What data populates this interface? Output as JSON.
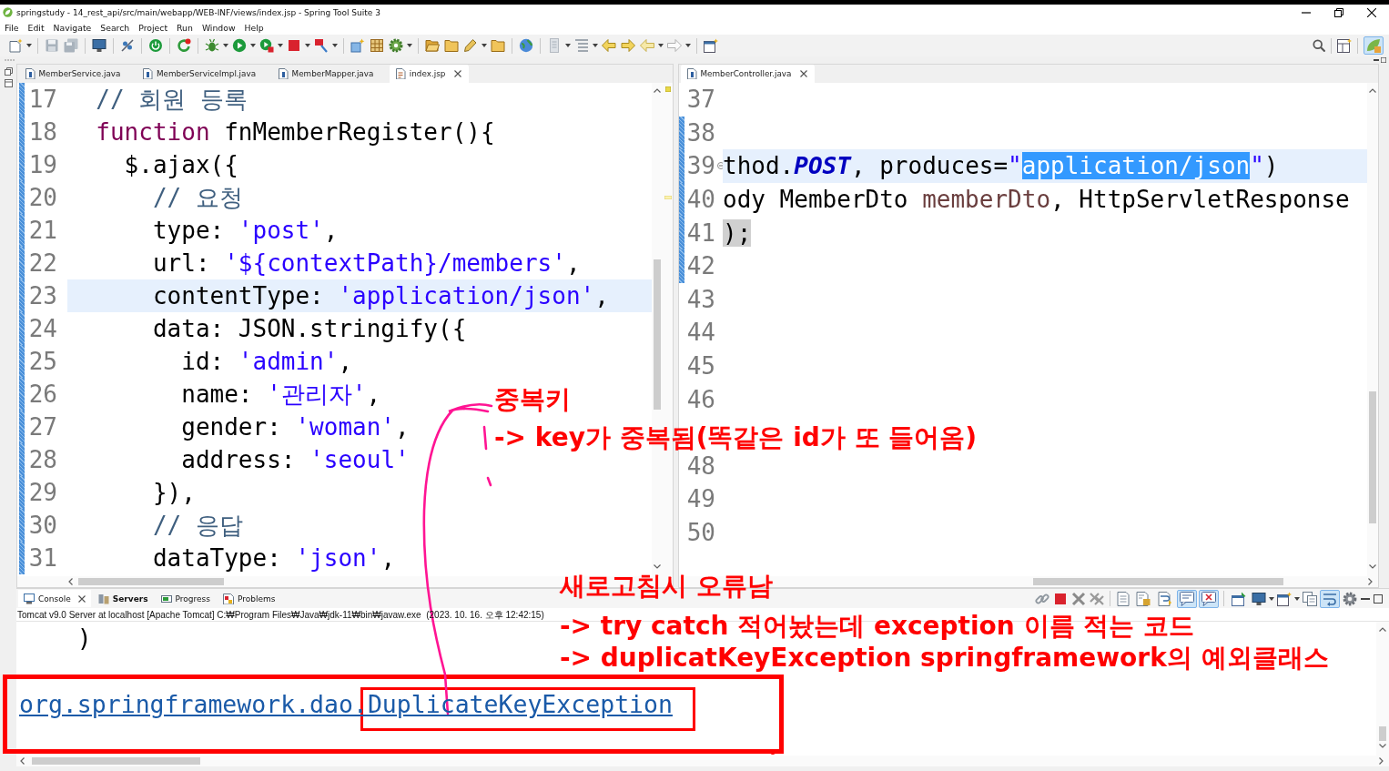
{
  "window": {
    "title": "springstudy - 14_rest_api/src/main/webapp/WEB-INF/views/index.jsp - Spring Tool Suite 3"
  },
  "menu": [
    "File",
    "Edit",
    "Navigate",
    "Search",
    "Project",
    "Run",
    "Window",
    "Help"
  ],
  "perspective_button": {
    "selected": true
  },
  "left_editor": {
    "tabs": [
      {
        "label": "MemberService.java",
        "kind": "java",
        "selected": false
      },
      {
        "label": "MemberServiceImpl.java",
        "kind": "java",
        "selected": false
      },
      {
        "label": "MemberMapper.java",
        "kind": "java",
        "selected": false
      },
      {
        "label": "index.jsp",
        "kind": "jsp",
        "selected": true
      }
    ],
    "lines": [
      {
        "number": "17",
        "in_range": true,
        "current": false,
        "tokens": [
          {
            "text": "  // 회원 등록",
            "kind": "comment"
          }
        ]
      },
      {
        "number": "18",
        "in_range": true,
        "current": false,
        "tokens": [
          {
            "text": "  function",
            "kind": "keyword"
          },
          {
            "text": " fnMemberRegister(){",
            "kind": "plain"
          }
        ]
      },
      {
        "number": "19",
        "in_range": true,
        "current": false,
        "tokens": [
          {
            "text": "    $.ajax({",
            "kind": "plain"
          }
        ]
      },
      {
        "number": "20",
        "in_range": true,
        "current": false,
        "tokens": [
          {
            "text": "      // 요청",
            "kind": "comment"
          }
        ]
      },
      {
        "number": "21",
        "in_range": true,
        "current": false,
        "tokens": [
          {
            "text": "      type: ",
            "kind": "plain"
          },
          {
            "text": "'post'",
            "kind": "string"
          },
          {
            "text": ",",
            "kind": "plain"
          }
        ]
      },
      {
        "number": "22",
        "in_range": true,
        "current": false,
        "tokens": [
          {
            "text": "      url: ",
            "kind": "plain"
          },
          {
            "text": "'${contextPath}/members'",
            "kind": "string"
          },
          {
            "text": ",",
            "kind": "plain"
          }
        ]
      },
      {
        "number": "23",
        "in_range": true,
        "current": true,
        "tokens": [
          {
            "text": "      contentType: ",
            "kind": "plain"
          },
          {
            "text": "'application/json'",
            "kind": "string"
          },
          {
            "text": ",",
            "kind": "plain"
          }
        ]
      },
      {
        "number": "24",
        "in_range": true,
        "current": false,
        "tokens": [
          {
            "text": "      data: JSON.stringify({",
            "kind": "plain"
          }
        ]
      },
      {
        "number": "25",
        "in_range": true,
        "current": false,
        "tokens": [
          {
            "text": "        id: ",
            "kind": "plain"
          },
          {
            "text": "'admin'",
            "kind": "string"
          },
          {
            "text": ",",
            "kind": "plain"
          }
        ]
      },
      {
        "number": "26",
        "in_range": true,
        "current": false,
        "tokens": [
          {
            "text": "        name: ",
            "kind": "plain"
          },
          {
            "text": "'관리자'",
            "kind": "string"
          },
          {
            "text": ",",
            "kind": "plain"
          }
        ]
      },
      {
        "number": "27",
        "in_range": true,
        "current": false,
        "tokens": [
          {
            "text": "        gender: ",
            "kind": "plain"
          },
          {
            "text": "'woman'",
            "kind": "string"
          },
          {
            "text": ",",
            "kind": "plain"
          }
        ]
      },
      {
        "number": "28",
        "in_range": true,
        "current": false,
        "tokens": [
          {
            "text": "        address: ",
            "kind": "plain"
          },
          {
            "text": "'seoul'",
            "kind": "string"
          }
        ]
      },
      {
        "number": "29",
        "in_range": true,
        "current": false,
        "tokens": [
          {
            "text": "      }),",
            "kind": "plain"
          }
        ]
      },
      {
        "number": "30",
        "in_range": true,
        "current": false,
        "tokens": [
          {
            "text": "      // 응답",
            "kind": "comment"
          }
        ]
      },
      {
        "number": "31",
        "in_range": true,
        "current": false,
        "tokens": [
          {
            "text": "      dataType: ",
            "kind": "plain"
          },
          {
            "text": "'json'",
            "kind": "string"
          },
          {
            "text": ",",
            "kind": "plain"
          }
        ]
      }
    ]
  },
  "right_editor": {
    "tabs": [
      {
        "label": "MemberController.java",
        "kind": "java",
        "selected": true
      }
    ],
    "lines": [
      {
        "kind": "line",
        "number": "37",
        "in_range": false,
        "current": false
      },
      {
        "kind": "line",
        "number": "38",
        "in_range": true,
        "current": false
      },
      {
        "kind": "line",
        "number": "39",
        "in_range": true,
        "current": true,
        "fold": {
          "expanded": true
        },
        "tokens": [
          {
            "text": "thod.",
            "kind": "plain"
          },
          {
            "text": "POST",
            "kind": "constant"
          },
          {
            "text": ", produces=",
            "kind": "plain"
          },
          {
            "text": "\"",
            "kind": "string"
          },
          {
            "text": "application/json",
            "kind": "selection"
          },
          {
            "text": "\"",
            "kind": "string"
          },
          {
            "text": ")",
            "kind": "plain"
          }
        ]
      },
      {
        "kind": "line",
        "number": "40",
        "in_range": true,
        "current": false,
        "tokens": [
          {
            "text": "ody MemberDto ",
            "kind": "plain"
          },
          {
            "text": "memberDto",
            "kind": "param"
          },
          {
            "text": ", HttpServletResponse",
            "kind": "plain"
          }
        ]
      },
      {
        "kind": "line",
        "number": "41",
        "in_range": true,
        "current": false,
        "tokens": [
          {
            "text": ");",
            "kind": "match"
          }
        ]
      },
      {
        "kind": "line",
        "number": "42",
        "in_range": true,
        "current": false
      },
      {
        "kind": "line",
        "number": "43",
        "in_range": false,
        "current": false
      },
      {
        "kind": "line",
        "number": "44",
        "in_range": false,
        "current": false
      },
      {
        "kind": "line",
        "number": "45",
        "in_range": false,
        "current": false
      },
      {
        "kind": "line",
        "number": "46",
        "in_range": false,
        "current": false
      },
      {
        "kind": "covered"
      },
      {
        "kind": "line",
        "number": "48",
        "in_range": false,
        "current": false
      },
      {
        "kind": "line",
        "number": "49",
        "in_range": false,
        "current": false
      },
      {
        "kind": "line",
        "number": "50",
        "in_range": false,
        "current": false
      }
    ]
  },
  "console": {
    "tabs": [
      {
        "label": "Console",
        "kind": "console",
        "selected": true,
        "updated": false
      },
      {
        "label": "Servers",
        "kind": "servers",
        "selected": false,
        "updated": true
      },
      {
        "label": "Progress",
        "kind": "progress",
        "selected": false,
        "updated": false
      },
      {
        "label": "Problems",
        "kind": "problems",
        "selected": false,
        "updated": false
      }
    ],
    "toolbar_toggles": [
      {
        "selected": false
      },
      {
        "selected": false
      },
      {
        "selected": true
      },
      {
        "selected": true
      },
      {
        "selected": false
      },
      {
        "selected": true
      }
    ],
    "process": "Tomcat v9.0 Server at localhost [Apache Tomcat] C:₩Program Files₩Java₩jdk-11₩bin₩javaw.exe  (2023. 10. 16. 오후 12:42:15)",
    "output": [
      {
        "kind": "text",
        "text": "    )"
      },
      {
        "kind": "link",
        "text": "org.springframework.dao.DuplicateKeyException"
      }
    ]
  },
  "annotations": [
    "중복키",
    "-> key가 중복됨(똑같은 id가 또 들어옴)",
    "새로고침시 오류남",
    "-> try catch 적어놨는데 exception 이름 적는 코드",
    "-> duplicatKeyException springframework의 예외클래스"
  ]
}
